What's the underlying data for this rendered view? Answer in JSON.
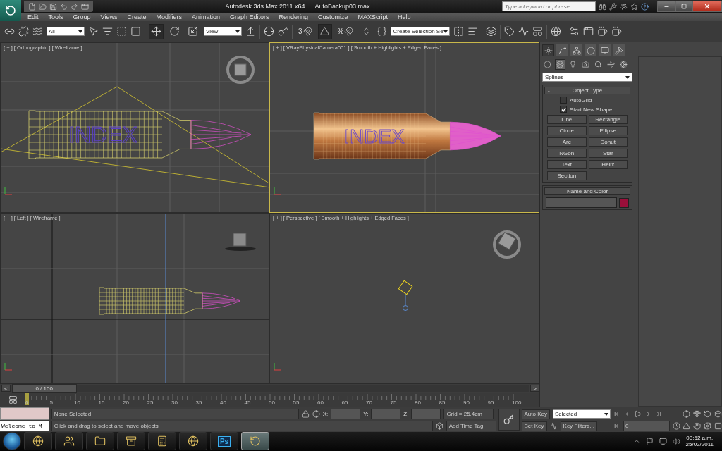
{
  "title_bar": {
    "app_title": "Autodesk 3ds Max  2011 x64",
    "file_name": "AutoBackup03.max",
    "search": {
      "placeholder": "Type a keyword or phrase"
    }
  },
  "menu": [
    "Edit",
    "Tools",
    "Group",
    "Views",
    "Create",
    "Modifiers",
    "Animation",
    "Graph Editors",
    "Rendering",
    "Customize",
    "MAXScript",
    "Help"
  ],
  "toolbar": {
    "selection_filter": "All",
    "reference_coordinate": "View",
    "named_selection": "Create Selection Se",
    "transforms": [
      {
        "kind": "move",
        "selected": true
      },
      {
        "kind": "rotate",
        "selected": false
      },
      {
        "kind": "scale",
        "selected": false
      }
    ],
    "snaps": [
      {
        "kind": "snap",
        "label": "3",
        "selected": false
      },
      {
        "kind": "angle",
        "selected": true
      },
      {
        "kind": "percent",
        "label": "%",
        "selected": false
      },
      {
        "kind": "spinner",
        "selected": false
      }
    ]
  },
  "viewports": [
    {
      "label": "[ + ] [ Orthographic ] [ Wireframe ]",
      "kind": "ortho",
      "active": false,
      "scene_text": "INDEX"
    },
    {
      "label": "[ + ] [ VRayPhysicalCamera001 ] [ Smooth + Highlights + Edged Faces ]",
      "kind": "camera",
      "active": true,
      "scene_text": "INDEX"
    },
    {
      "label": "[ + ] [ Left ] [ Wireframe ]",
      "kind": "left",
      "active": false
    },
    {
      "label": "[ + ] [ Perspective ] [ Smooth + Highlights + Edged Faces ]",
      "kind": "perspective",
      "active": false
    }
  ],
  "command_panel": {
    "tabs": [
      {
        "kind": "create",
        "selected": true
      },
      {
        "kind": "modify",
        "selected": false
      },
      {
        "kind": "hierarchy",
        "selected": false
      },
      {
        "kind": "motion",
        "selected": false
      },
      {
        "kind": "display",
        "selected": false
      },
      {
        "kind": "utilities",
        "selected": false
      }
    ],
    "categories": [
      {
        "kind": "geometry",
        "selected": false
      },
      {
        "kind": "shapes",
        "selected": true
      },
      {
        "kind": "lights",
        "selected": false
      },
      {
        "kind": "cameras",
        "selected": false
      },
      {
        "kind": "helpers",
        "selected": false
      },
      {
        "kind": "space_warps",
        "selected": false
      },
      {
        "kind": "systems",
        "selected": false
      }
    ],
    "type_dropdown": "Splines",
    "object_type": {
      "toggle": "-",
      "title": "Object Type",
      "options": [
        {
          "label": "AutoGrid",
          "checked": false
        },
        {
          "label": "Start New Shape",
          "checked": true
        }
      ],
      "buttons": [
        "Line",
        "Rectangle",
        "Circle",
        "Ellipse",
        "Arc",
        "Donut",
        "NGon",
        "Star",
        "Text",
        "Helix",
        "Section"
      ]
    },
    "name_and_color": {
      "toggle": "-",
      "title": "Name and Color"
    }
  },
  "time_slider": {
    "prev": "<",
    "position": "0 / 100",
    "next": ">",
    "level": 0
  },
  "track_bar": {
    "ticks": [
      "0",
      "5",
      "10",
      "15",
      "20",
      "25",
      "30",
      "35",
      "40",
      "45",
      "50",
      "55",
      "60",
      "65",
      "70",
      "75",
      "80",
      "85",
      "90",
      "95",
      "100"
    ]
  },
  "status": {
    "listener_output": "Welcome to M",
    "selection": "None Selected",
    "prompt": "Click and drag to select and move objects",
    "coords": [
      "X:",
      "Y:",
      "Z:"
    ],
    "grid": "Grid = 25.4cm",
    "time_tag": "Add Time Tag",
    "auto_key": "Auto Key",
    "key_set": "Selected",
    "set_key": "Set Key",
    "key_filters": "Key Filters...",
    "frame": "0"
  },
  "taskbar": {
    "apps": [
      {
        "kind": "browser",
        "selected": false
      },
      {
        "kind": "messenger",
        "selected": false
      },
      {
        "kind": "explorer",
        "selected": false
      },
      {
        "kind": "archiver",
        "selected": false
      },
      {
        "kind": "calculator",
        "selected": false
      },
      {
        "kind": "globe",
        "selected": false
      },
      {
        "kind": "photoshop",
        "label": "Ps",
        "selected": false
      },
      {
        "kind": "max",
        "selected": true
      }
    ],
    "time": "03:52 a.m.",
    "date": "25/02/2011"
  }
}
